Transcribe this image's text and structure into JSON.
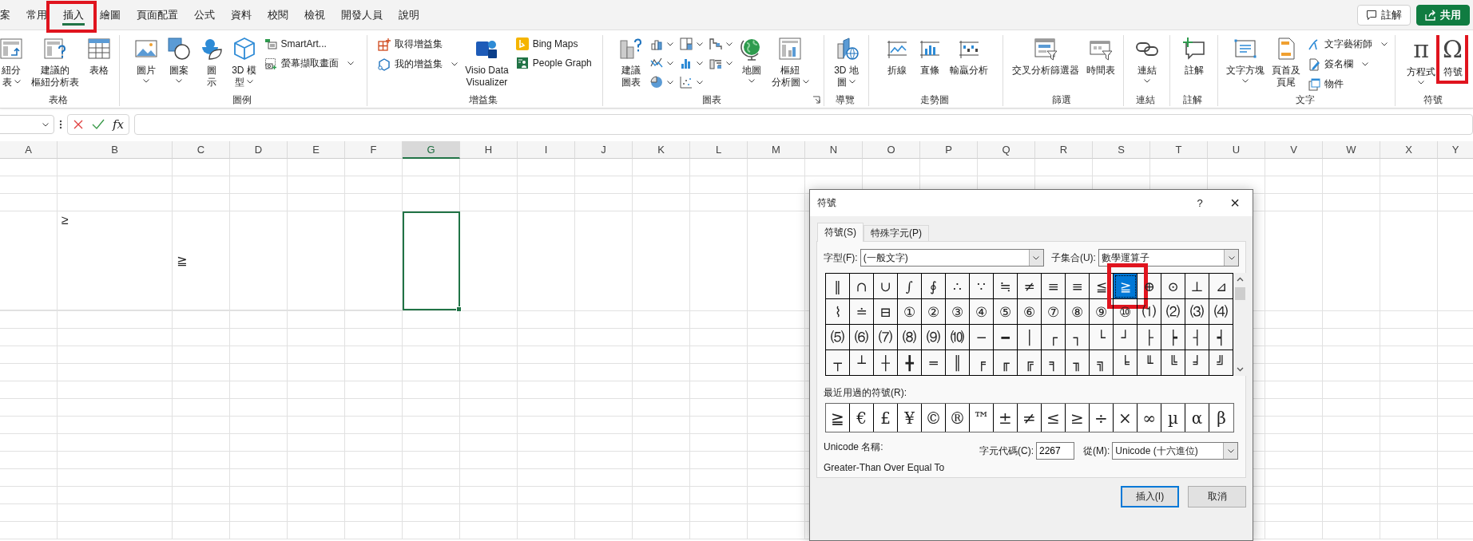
{
  "ribbon_tabs": [
    {
      "label": "案",
      "selected": false,
      "highlighted": false
    },
    {
      "label": "常用",
      "selected": false,
      "highlighted": false
    },
    {
      "label": "插入",
      "selected": true,
      "highlighted": true
    },
    {
      "label": "繪圖",
      "selected": false,
      "highlighted": false
    },
    {
      "label": "頁面配置",
      "selected": false,
      "highlighted": false
    },
    {
      "label": "公式",
      "selected": false,
      "highlighted": false
    },
    {
      "label": "資料",
      "selected": false,
      "highlighted": false
    },
    {
      "label": "校閱",
      "selected": false,
      "highlighted": false
    },
    {
      "label": "檢視",
      "selected": false,
      "highlighted": false
    },
    {
      "label": "開發人員",
      "selected": false,
      "highlighted": false
    },
    {
      "label": "說明",
      "selected": false,
      "highlighted": false
    }
  ],
  "header_buttons": [
    {
      "kind": "comments",
      "label": "註解"
    },
    {
      "kind": "share",
      "label": "共用"
    }
  ],
  "ribbon_groups": [
    {
      "label": "表格",
      "launcher": false,
      "items": [
        {
          "kind": "large",
          "label_lines": [
            "紐分",
            "表"
          ],
          "dropdown": true
        },
        {
          "kind": "large",
          "label_lines": [
            "建議的",
            "樞紐分析表"
          ],
          "dropdown": false
        },
        {
          "kind": "large",
          "label_lines": [
            "表格"
          ],
          "dropdown": false
        }
      ]
    },
    {
      "label": "圖例",
      "launcher": false,
      "items": [
        {
          "kind": "large",
          "label_lines": [
            "圖片"
          ],
          "dropdown": true
        },
        {
          "kind": "large",
          "label_lines": [
            "圖案"
          ],
          "dropdown": true
        },
        {
          "kind": "large",
          "label_lines": [
            "圖",
            "示"
          ],
          "dropdown": false
        },
        {
          "kind": "large",
          "label_lines": [
            "3D 模",
            "型"
          ],
          "dropdown": true
        },
        {
          "kind": "stack",
          "items": [
            {
              "label": "SmartArt...",
              "dropdown": false
            },
            {
              "label": "螢幕擷取畫面",
              "dropdown": true
            }
          ]
        }
      ]
    },
    {
      "label": "增益集",
      "launcher": false,
      "items": [
        {
          "kind": "stack",
          "items": [
            {
              "label": "取得增益集",
              "dropdown": false
            },
            {
              "label": "我的增益集",
              "dropdown": true
            }
          ]
        },
        {
          "kind": "large",
          "label_lines": [
            "Visio Data",
            "Visualizer"
          ],
          "dropdown": false
        },
        {
          "kind": "stack",
          "items": [
            {
              "label": "Bing Maps",
              "dropdown": false
            },
            {
              "label": "People Graph",
              "dropdown": false
            }
          ]
        }
      ]
    },
    {
      "label": "圖表",
      "launcher": true,
      "items": [
        {
          "kind": "large",
          "label_lines": [
            "建議",
            "圖表"
          ],
          "dropdown": false
        },
        {
          "kind": "icons",
          "items": [
            {
              "dropdown": true
            },
            {
              "dropdown": true
            },
            {
              "dropdown": true
            },
            {
              "dropdown": true
            },
            {
              "dropdown": true
            },
            {
              "dropdown": true
            },
            {
              "dropdown": true
            },
            {
              "dropdown": true
            }
          ]
        },
        {
          "kind": "large",
          "label_lines": [
            "地圖"
          ],
          "dropdown": true
        },
        {
          "kind": "large",
          "label_lines": [
            "樞紐",
            "分析圖"
          ],
          "dropdown": true
        }
      ]
    },
    {
      "label": "導覽",
      "launcher": false,
      "items": [
        {
          "kind": "large",
          "label_lines": [
            "3D 地",
            "圖"
          ],
          "dropdown": true
        }
      ]
    },
    {
      "label": "走勢圖",
      "launcher": false,
      "items": [
        {
          "kind": "large",
          "label_lines": [
            "折線"
          ],
          "dropdown": false
        },
        {
          "kind": "large",
          "label_lines": [
            "直條"
          ],
          "dropdown": false
        },
        {
          "kind": "large",
          "label_lines": [
            "輸贏分析"
          ],
          "dropdown": false
        }
      ]
    },
    {
      "label": "篩選",
      "launcher": false,
      "items": [
        {
          "kind": "large",
          "label_lines": [
            "交叉分析篩選器"
          ],
          "dropdown": false
        },
        {
          "kind": "large",
          "label_lines": [
            "時間表"
          ],
          "dropdown": false
        }
      ]
    },
    {
      "label": "連結",
      "launcher": false,
      "items": [
        {
          "kind": "large",
          "label_lines": [
            "連結"
          ],
          "dropdown": true
        }
      ]
    },
    {
      "label": "註解",
      "launcher": false,
      "items": [
        {
          "kind": "large",
          "label_lines": [
            "註解"
          ],
          "dropdown": false
        }
      ]
    },
    {
      "label": "文字",
      "launcher": false,
      "items": [
        {
          "kind": "large",
          "label_lines": [
            "文字方塊"
          ],
          "dropdown": true
        },
        {
          "kind": "large",
          "label_lines": [
            "頁首及",
            "頁尾"
          ],
          "dropdown": false
        },
        {
          "kind": "stack",
          "items": [
            {
              "label": "文字藝術師",
              "dropdown": true
            },
            {
              "label": "簽名欄",
              "dropdown": true
            },
            {
              "label": "物件",
              "dropdown": false
            }
          ]
        }
      ]
    },
    {
      "label": "符號",
      "launcher": false,
      "items": [
        {
          "kind": "glyph",
          "glyph": "π",
          "label_lines": [
            "方程式"
          ],
          "dropdown": true,
          "highlighted": false
        },
        {
          "kind": "glyph",
          "glyph": "Ω",
          "label_lines": [
            "符號"
          ],
          "dropdown": false,
          "highlighted": true
        }
      ]
    }
  ],
  "formula_bar": {
    "function_label": "fx"
  },
  "sheet": {
    "columns": [
      {
        "label": "A",
        "selected": false
      },
      {
        "label": "B",
        "selected": false
      },
      {
        "label": "C",
        "selected": false
      },
      {
        "label": "D",
        "selected": false
      },
      {
        "label": "E",
        "selected": false
      },
      {
        "label": "F",
        "selected": false
      },
      {
        "label": "G",
        "selected": true
      },
      {
        "label": "H",
        "selected": false
      },
      {
        "label": "I",
        "selected": false
      },
      {
        "label": "J",
        "selected": false
      },
      {
        "label": "K",
        "selected": false
      },
      {
        "label": "L",
        "selected": false
      },
      {
        "label": "M",
        "selected": false
      },
      {
        "label": "N",
        "selected": false
      },
      {
        "label": "O",
        "selected": false
      },
      {
        "label": "P",
        "selected": false
      },
      {
        "label": "Q",
        "selected": false
      },
      {
        "label": "R",
        "selected": false
      },
      {
        "label": "S",
        "selected": false
      },
      {
        "label": "T",
        "selected": false
      },
      {
        "label": "U",
        "selected": false
      },
      {
        "label": "V",
        "selected": false
      },
      {
        "label": "W",
        "selected": false
      },
      {
        "label": "X",
        "selected": false
      },
      {
        "label": "Y",
        "selected": false
      }
    ],
    "rows": [
      {
        "cells": []
      },
      {
        "cells": []
      },
      {
        "cells": []
      },
      {
        "cells": [
          {
            "selected": false
          },
          {
            "text": "≥",
            "selected": false
          },
          {
            "text": "≧",
            "selected": false
          },
          {
            "selected": false
          },
          {
            "selected": false
          },
          {
            "selected": false
          },
          {
            "selected": true
          }
        ]
      }
    ]
  },
  "dialog": {
    "title": "符號",
    "help": "?",
    "close": "×",
    "tabs": [
      {
        "label": "符號(S)",
        "selected": true
      },
      {
        "label": "特殊字元(P)",
        "selected": false
      }
    ],
    "font_label": "字型(F):",
    "font_value": "(一般文字)",
    "subset_label": "子集合(U):",
    "subset_value": "數學運算子",
    "symbols": [
      {
        "char": "‖",
        "selected": false,
        "highlighted": false
      },
      {
        "char": "∩",
        "selected": false,
        "highlighted": false
      },
      {
        "char": "∪",
        "selected": false,
        "highlighted": false
      },
      {
        "char": "∫",
        "selected": false,
        "highlighted": false
      },
      {
        "char": "∮",
        "selected": false,
        "highlighted": false
      },
      {
        "char": "∴",
        "selected": false,
        "highlighted": false
      },
      {
        "char": "∵",
        "selected": false,
        "highlighted": false
      },
      {
        "char": "≒",
        "selected": false,
        "highlighted": false
      },
      {
        "char": "≠",
        "selected": false,
        "highlighted": false
      },
      {
        "char": "≡",
        "selected": false,
        "highlighted": false
      },
      {
        "char": "≡",
        "selected": false,
        "highlighted": false
      },
      {
        "char": "≦",
        "selected": false,
        "highlighted": false
      },
      {
        "char": "≧",
        "selected": true,
        "highlighted": true
      },
      {
        "char": "⊕",
        "selected": false,
        "highlighted": false
      },
      {
        "char": "⊙",
        "selected": false,
        "highlighted": false
      },
      {
        "char": "⊥",
        "selected": false,
        "highlighted": false
      },
      {
        "char": "⊿",
        "selected": false,
        "highlighted": false
      },
      {
        "char": "⌇",
        "selected": false,
        "highlighted": false
      },
      {
        "char": "≐",
        "selected": false,
        "highlighted": false
      },
      {
        "char": "⊟",
        "selected": false,
        "highlighted": false
      },
      {
        "char": "①",
        "selected": false,
        "highlighted": false
      },
      {
        "char": "②",
        "selected": false,
        "highlighted": false
      },
      {
        "char": "③",
        "selected": false,
        "highlighted": false
      },
      {
        "char": "④",
        "selected": false,
        "highlighted": false
      },
      {
        "char": "⑤",
        "selected": false,
        "highlighted": false
      },
      {
        "char": "⑥",
        "selected": false,
        "highlighted": false
      },
      {
        "char": "⑦",
        "selected": false,
        "highlighted": false
      },
      {
        "char": "⑧",
        "selected": false,
        "highlighted": false
      },
      {
        "char": "⑨",
        "selected": false,
        "highlighted": false
      },
      {
        "char": "⑩",
        "selected": false,
        "highlighted": false
      },
      {
        "char": "⑴",
        "selected": false,
        "highlighted": false
      },
      {
        "char": "⑵",
        "selected": false,
        "highlighted": false
      },
      {
        "char": "⑶",
        "selected": false,
        "highlighted": false
      },
      {
        "char": "⑷",
        "selected": false,
        "highlighted": false
      },
      {
        "char": "⑸",
        "selected": false,
        "highlighted": false
      },
      {
        "char": "⑹",
        "selected": false,
        "highlighted": false
      },
      {
        "char": "⑺",
        "selected": false,
        "highlighted": false
      },
      {
        "char": "⑻",
        "selected": false,
        "highlighted": false
      },
      {
        "char": "⑼",
        "selected": false,
        "highlighted": false
      },
      {
        "char": "⑽",
        "selected": false,
        "highlighted": false
      },
      {
        "char": "─",
        "selected": false,
        "highlighted": false
      },
      {
        "char": "━",
        "selected": false,
        "highlighted": false
      },
      {
        "char": "│",
        "selected": false,
        "highlighted": false
      },
      {
        "char": "┌",
        "selected": false,
        "highlighted": false
      },
      {
        "char": "┐",
        "selected": false,
        "highlighted": false
      },
      {
        "char": "└",
        "selected": false,
        "highlighted": false
      },
      {
        "char": "┘",
        "selected": false,
        "highlighted": false
      },
      {
        "char": "├",
        "selected": false,
        "highlighted": false
      },
      {
        "char": "┝",
        "selected": false,
        "highlighted": false
      },
      {
        "char": "┤",
        "selected": false,
        "highlighted": false
      },
      {
        "char": "┥",
        "selected": false,
        "highlighted": false
      },
      {
        "char": "┬",
        "selected": false,
        "highlighted": false
      },
      {
        "char": "┴",
        "selected": false,
        "highlighted": false
      },
      {
        "char": "┼",
        "selected": false,
        "highlighted": false
      },
      {
        "char": "╋",
        "selected": false,
        "highlighted": false
      },
      {
        "char": "═",
        "selected": false,
        "highlighted": false
      },
      {
        "char": "║",
        "selected": false,
        "highlighted": false
      },
      {
        "char": "╒",
        "selected": false,
        "highlighted": false
      },
      {
        "char": "╓",
        "selected": false,
        "highlighted": false
      },
      {
        "char": "╔",
        "selected": false,
        "highlighted": false
      },
      {
        "char": "╕",
        "selected": false,
        "highlighted": false
      },
      {
        "char": "╖",
        "selected": false,
        "highlighted": false
      },
      {
        "char": "╗",
        "selected": false,
        "highlighted": false
      },
      {
        "char": "╘",
        "selected": false,
        "highlighted": false
      },
      {
        "char": "╙",
        "selected": false,
        "highlighted": false
      },
      {
        "char": "╚",
        "selected": false,
        "highlighted": false
      },
      {
        "char": "╛",
        "selected": false,
        "highlighted": false
      },
      {
        "char": "╝",
        "selected": false,
        "highlighted": false
      }
    ],
    "recent_label": "最近用過的符號(R):",
    "recent": [
      "≧",
      "€",
      "£",
      "¥",
      "©",
      "®",
      "™",
      "±",
      "≠",
      "≤",
      "≥",
      "÷",
      "×",
      "∞",
      "µ",
      "α",
      "β"
    ],
    "unicode_name_label": "Unicode 名稱:",
    "unicode_name": "Greater-Than Over Equal To",
    "code_label": "字元代碼(C):",
    "code_value": "2267",
    "from_label": "從(M):",
    "from_value": "Unicode (十六進位)",
    "buttons": [
      {
        "label": "插入(I)",
        "default": true
      },
      {
        "label": "取消",
        "default": false
      }
    ]
  }
}
